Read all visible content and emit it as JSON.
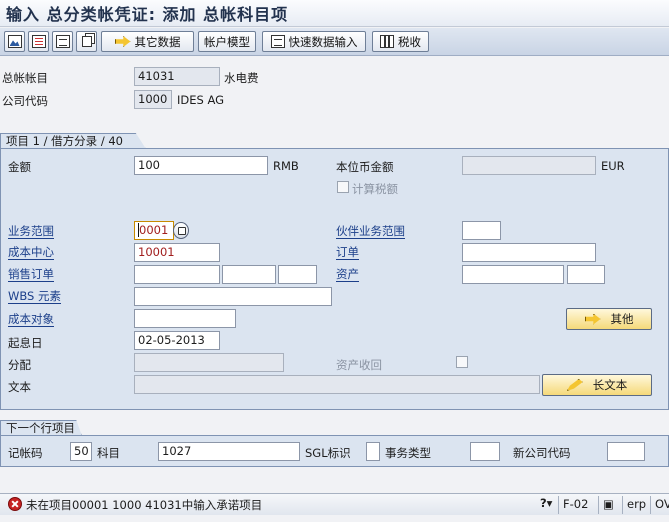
{
  "window": {
    "title": "输入 总分类帐凭证: 添加 总帐科目项"
  },
  "toolbar": {
    "other_data": "其它数据",
    "account_model": "帐户模型",
    "fast_entry": "快速数据输入",
    "taxes": "税收"
  },
  "header": {
    "gl_account_label": "总帐帐目",
    "gl_account_value": "41031",
    "gl_account_desc": "水电费",
    "company_code_label": "公司代码",
    "company_code_value": "1000",
    "company_code_name": "IDES AG"
  },
  "item": {
    "group_title": "项目 1 / 借方分录 / 40",
    "amount_label": "金额",
    "amount_value": "100",
    "currency": "RMB",
    "local_amount_label": "本位币金额",
    "local_amount_value": "",
    "local_currency": "EUR",
    "calc_tax_label": "计算税额",
    "business_area_label": "业务范围",
    "business_area_value": "0001",
    "trading_partner_label": "伙伴业务范围",
    "trading_partner_value": "",
    "cost_center_label": "成本中心",
    "cost_center_value": "10001",
    "order_label": "订单",
    "order_value": "",
    "sales_order_label": "销售订单",
    "asset_label": "资产",
    "wbs_label": "WBS 元素",
    "cost_object_label": "成本对象",
    "other_button": "其他",
    "value_date_label": "起息日",
    "value_date_value": "02-05-2013",
    "assignment_label": "分配",
    "asset_retirement_label": "资产收回",
    "text_label": "文本",
    "long_text_button": "长文本"
  },
  "next_item": {
    "group_title": "下一个行项目",
    "posting_key_label": "记帐码",
    "posting_key_value": "50",
    "account_label": "科目",
    "account_value": "1027",
    "sgl_label": "SGL标识",
    "trans_type_label": "事务类型",
    "new_cocode_label": "新公司代码"
  },
  "status": {
    "message": "未在项目00001 1000 41031中输入承诺项目",
    "transaction": "F-02",
    "system": "erp",
    "mode": "OV"
  }
}
